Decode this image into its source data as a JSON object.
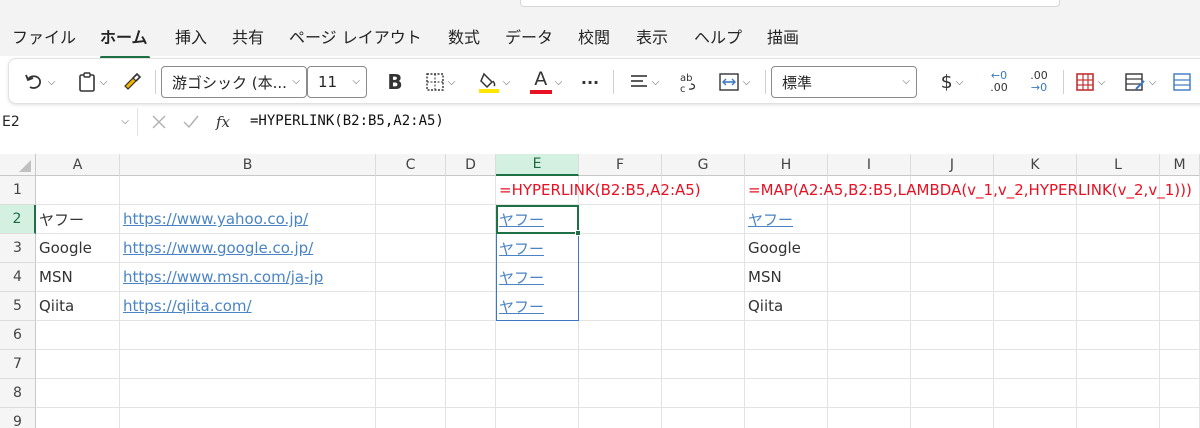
{
  "menu": {
    "tabs": [
      {
        "label": "ファイル",
        "active": false
      },
      {
        "label": "ホーム",
        "active": true
      },
      {
        "label": "挿入",
        "active": false
      },
      {
        "label": "共有",
        "active": false
      },
      {
        "label": "ページ レイアウト",
        "active": false
      },
      {
        "label": "数式",
        "active": false
      },
      {
        "label": "データ",
        "active": false
      },
      {
        "label": "校閲",
        "active": false
      },
      {
        "label": "表示",
        "active": false
      },
      {
        "label": "ヘルプ",
        "active": false
      },
      {
        "label": "描画",
        "active": false
      }
    ]
  },
  "toolbar": {
    "font_name": "游ゴシック (本...",
    "font_size": "11",
    "bold_label": "B",
    "font_color_label": "A",
    "more_label": "···",
    "number_format": "標準",
    "currency_label": "$",
    "inc_decimal_top": "←0",
    "inc_decimal_bottom": ".00",
    "dec_decimal_top": ".00",
    "dec_decimal_bottom": "→0",
    "fill_color": "#ffe600",
    "font_color": "#e81123"
  },
  "formula_bar": {
    "name_box": "E2",
    "formula": "=HYPERLINK(B2:B5,A2:A5)",
    "fx_label": "fx"
  },
  "sheet": {
    "columns": [
      "A",
      "B",
      "C",
      "D",
      "E",
      "F",
      "G",
      "H",
      "I",
      "J",
      "K",
      "L",
      "M"
    ],
    "rows": [
      "1",
      "2",
      "3",
      "4",
      "5",
      "6",
      "7",
      "8",
      "9"
    ],
    "selected_column": "E",
    "selected_row": "2",
    "e1_text": "=HYPERLINK(B2:B5,A2:A5)",
    "h1_text": "=MAP(A2:A5,B2:B5,LAMBDA(v_1,v_2,HYPERLINK(v_2,v_1)))",
    "col_a": [
      "ヤフー",
      "Google",
      "MSN",
      "Qiita"
    ],
    "col_b": [
      "https://www.yahoo.co.jp/",
      "https://www.google.co.jp/",
      "https://www.msn.com/ja-jp",
      "https://qiita.com/"
    ],
    "col_e": [
      "ヤフー",
      "ヤフー",
      "ヤフー",
      "ヤフー"
    ],
    "col_h": [
      "ヤフー",
      "Google",
      "MSN",
      "Qiita"
    ],
    "link_color": "#4a84c4",
    "formula_note_color": "#e81123",
    "accent": "#1e7145"
  }
}
